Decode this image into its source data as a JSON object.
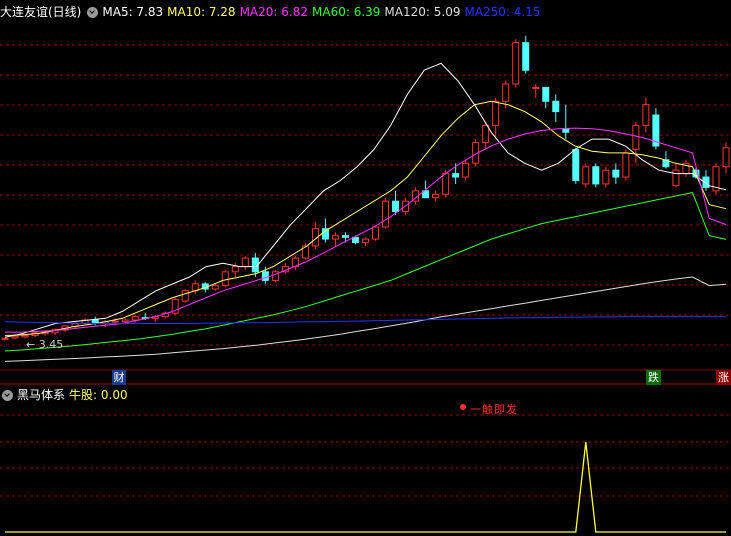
{
  "main_header": {
    "title": "大连友谊(日线)",
    "ma": [
      {
        "label": "MA5: 7.83",
        "color": "#ffffff"
      },
      {
        "label": "MA10: 7.28",
        "color": "#ffff66"
      },
      {
        "label": "MA20: 6.82",
        "color": "#ff33ff"
      },
      {
        "label": "MA60: 6.39",
        "color": "#33ff33"
      },
      {
        "label": "MA120: 5.09",
        "color": "#dddddd"
      },
      {
        "label": "MA250: 4.15",
        "color": "#2233ff"
      }
    ]
  },
  "low_label": "← 3.45",
  "markers": {
    "cai": "财",
    "die": "跌",
    "zhang": "涨"
  },
  "sub_header": {
    "title": "黑马体系",
    "indicator": "牛股: 0.00"
  },
  "signal_text": "一触即发",
  "colors": {
    "up": "#ff3333",
    "down": "#54ffff",
    "bg": "#000000",
    "grid": "#8b0000"
  },
  "chart_data": {
    "type": "candlestick",
    "ohlc": [
      [
        3.5,
        3.55,
        3.45,
        3.52
      ],
      [
        3.53,
        3.6,
        3.5,
        3.58
      ],
      [
        3.56,
        3.62,
        3.52,
        3.6
      ],
      [
        3.6,
        3.7,
        3.55,
        3.68
      ],
      [
        3.65,
        3.72,
        3.6,
        3.7
      ],
      [
        3.68,
        3.8,
        3.62,
        3.78
      ],
      [
        3.76,
        3.9,
        3.7,
        3.88
      ],
      [
        3.86,
        4.0,
        3.8,
        3.95
      ],
      [
        3.95,
        4.1,
        3.9,
        4.05
      ],
      [
        4.05,
        4.15,
        3.9,
        3.95
      ],
      [
        3.95,
        4.05,
        3.85,
        4.0
      ],
      [
        4.0,
        4.1,
        3.9,
        4.02
      ],
      [
        4.0,
        4.1,
        3.92,
        4.05
      ],
      [
        4.05,
        4.2,
        3.98,
        4.15
      ],
      [
        4.12,
        4.25,
        4.05,
        4.1
      ],
      [
        4.1,
        4.2,
        4.0,
        4.15
      ],
      [
        4.15,
        4.3,
        4.1,
        4.25
      ],
      [
        4.25,
        4.7,
        4.2,
        4.65
      ],
      [
        4.6,
        4.95,
        4.55,
        4.9
      ],
      [
        4.9,
        5.2,
        4.8,
        5.1
      ],
      [
        5.1,
        5.15,
        4.85,
        4.95
      ],
      [
        4.95,
        5.1,
        4.9,
        5.05
      ],
      [
        5.05,
        5.5,
        5.0,
        5.45
      ],
      [
        5.45,
        5.7,
        5.3,
        5.6
      ],
      [
        5.6,
        5.9,
        5.5,
        5.85
      ],
      [
        5.85,
        6.0,
        5.3,
        5.45
      ],
      [
        5.45,
        5.6,
        5.1,
        5.2
      ],
      [
        5.2,
        5.5,
        5.15,
        5.45
      ],
      [
        5.45,
        5.7,
        5.4,
        5.6
      ],
      [
        5.6,
        5.9,
        5.5,
        5.85
      ],
      [
        5.85,
        6.3,
        5.8,
        6.2
      ],
      [
        6.2,
        6.9,
        6.1,
        6.7
      ],
      [
        6.7,
        7.0,
        6.3,
        6.4
      ],
      [
        6.4,
        6.6,
        6.2,
        6.5
      ],
      [
        6.5,
        6.6,
        6.3,
        6.45
      ],
      [
        6.45,
        6.5,
        6.25,
        6.3
      ],
      [
        6.3,
        6.45,
        6.2,
        6.4
      ],
      [
        6.4,
        6.8,
        6.35,
        6.75
      ],
      [
        6.75,
        7.6,
        6.7,
        7.5
      ],
      [
        7.5,
        7.8,
        7.1,
        7.2
      ],
      [
        7.2,
        7.6,
        7.1,
        7.5
      ],
      [
        7.5,
        7.9,
        7.4,
        7.8
      ],
      [
        7.8,
        8.1,
        7.7,
        7.6
      ],
      [
        7.6,
        7.8,
        7.5,
        7.7
      ],
      [
        7.7,
        8.4,
        7.6,
        8.3
      ],
      [
        8.3,
        8.6,
        8.0,
        8.2
      ],
      [
        8.2,
        8.7,
        8.1,
        8.6
      ],
      [
        8.6,
        9.3,
        8.5,
        9.2
      ],
      [
        9.2,
        9.8,
        9.0,
        9.7
      ],
      [
        9.7,
        10.5,
        9.3,
        10.4
      ],
      [
        10.4,
        11.0,
        10.2,
        10.9
      ],
      [
        10.9,
        12.2,
        10.8,
        12.1
      ],
      [
        12.1,
        12.3,
        11.2,
        11.3
      ],
      [
        10.8,
        10.9,
        10.5,
        10.8
      ],
      [
        10.8,
        10.8,
        10.2,
        10.4
      ],
      [
        10.4,
        10.6,
        9.8,
        10.1
      ],
      [
        9.6,
        10.3,
        9.3,
        9.5
      ],
      [
        9.0,
        9.05,
        8.0,
        8.1
      ],
      [
        8.0,
        8.6,
        7.9,
        8.5
      ],
      [
        8.5,
        8.6,
        7.9,
        8.0
      ],
      [
        8.0,
        8.5,
        7.9,
        8.4
      ],
      [
        8.4,
        8.6,
        8.0,
        8.2
      ],
      [
        8.2,
        9.0,
        8.1,
        8.9
      ],
      [
        9.0,
        9.8,
        8.6,
        9.7
      ],
      [
        9.7,
        10.5,
        9.5,
        10.3
      ],
      [
        10.0,
        10.2,
        9.0,
        9.1
      ],
      [
        8.7,
        8.95,
        8.45,
        8.5
      ],
      [
        7.95,
        8.6,
        7.9,
        8.4
      ],
      [
        8.3,
        8.7,
        8.2,
        8.6
      ],
      [
        8.4,
        8.45,
        8.15,
        8.2
      ],
      [
        8.2,
        8.4,
        7.8,
        7.9
      ],
      [
        7.8,
        8.6,
        7.7,
        8.5
      ],
      [
        8.5,
        9.2,
        8.3,
        9.05
      ]
    ],
    "ma_series": [
      {
        "name": "MA5",
        "color": "#ffffff",
        "values": [
          3.55,
          3.65,
          3.8,
          3.95,
          4.0,
          4.05,
          4.1,
          4.3,
          4.6,
          4.9,
          5.1,
          5.3,
          5.6,
          5.7,
          5.6,
          5.6,
          6.2,
          6.8,
          7.3,
          7.8,
          8.1,
          8.5,
          9.0,
          9.7,
          10.6,
          11.3,
          11.5,
          11.0,
          10.3,
          9.5,
          8.9,
          8.6,
          8.4,
          8.6,
          9.0,
          9.3,
          9.3,
          9.1,
          8.7,
          8.4,
          8.3,
          8.3,
          7.95,
          7.83
        ]
      },
      {
        "name": "MA10",
        "color": "#ffff66",
        "values": [
          3.6,
          3.62,
          3.66,
          3.75,
          3.85,
          3.92,
          4.0,
          4.1,
          4.3,
          4.5,
          4.7,
          4.85,
          5.0,
          5.2,
          5.3,
          5.4,
          5.6,
          5.9,
          6.2,
          6.6,
          6.9,
          7.2,
          7.5,
          7.8,
          8.2,
          8.8,
          9.4,
          9.9,
          10.3,
          10.4,
          10.3,
          10.1,
          9.8,
          9.4,
          9.1,
          8.95,
          8.9,
          8.9,
          8.85,
          8.75,
          8.6,
          8.5,
          7.4,
          7.28
        ]
      },
      {
        "name": "MA20",
        "color": "#ff33ff",
        "values": [
          3.7,
          3.7,
          3.72,
          3.75,
          3.8,
          3.85,
          3.9,
          3.95,
          4.05,
          4.15,
          4.3,
          4.5,
          4.7,
          4.9,
          5.05,
          5.2,
          5.35,
          5.55,
          5.75,
          6.0,
          6.25,
          6.5,
          6.75,
          7.05,
          7.4,
          7.8,
          8.2,
          8.55,
          8.85,
          9.1,
          9.3,
          9.45,
          9.55,
          9.6,
          9.62,
          9.6,
          9.55,
          9.45,
          9.35,
          9.2,
          9.05,
          8.9,
          7.0,
          6.82
        ]
      },
      {
        "name": "MA60",
        "color": "#33ff33",
        "values": [
          3.15,
          3.18,
          3.22,
          3.26,
          3.3,
          3.35,
          3.4,
          3.45,
          3.5,
          3.57,
          3.64,
          3.72,
          3.8,
          3.9,
          4.0,
          4.1,
          4.2,
          4.32,
          4.45,
          4.6,
          4.75,
          4.9,
          5.05,
          5.2,
          5.4,
          5.6,
          5.8,
          6.0,
          6.2,
          6.4,
          6.55,
          6.7,
          6.85,
          6.95,
          7.05,
          7.15,
          7.25,
          7.35,
          7.45,
          7.55,
          7.65,
          7.75,
          6.5,
          6.39
        ]
      },
      {
        "name": "MA120",
        "color": "#dddddd",
        "values": [
          2.85,
          2.87,
          2.89,
          2.91,
          2.93,
          2.95,
          2.98,
          3.0,
          3.03,
          3.06,
          3.1,
          3.14,
          3.18,
          3.22,
          3.27,
          3.32,
          3.38,
          3.44,
          3.5,
          3.57,
          3.64,
          3.72,
          3.8,
          3.88,
          3.96,
          4.05,
          4.14,
          4.22,
          4.3,
          4.38,
          4.46,
          4.54,
          4.62,
          4.7,
          4.78,
          4.86,
          4.94,
          5.02,
          5.1,
          5.17,
          5.24,
          5.3,
          5.05,
          5.09
        ]
      },
      {
        "name": "MA250",
        "color": "#2233ff",
        "values": [
          4.0,
          3.99,
          3.98,
          3.97,
          3.96,
          3.95,
          3.95,
          3.95,
          3.95,
          3.95,
          3.95,
          3.95,
          3.96,
          3.96,
          3.97,
          3.97,
          3.98,
          3.99,
          4.0,
          4.0,
          4.01,
          4.02,
          4.03,
          4.04,
          4.05,
          4.06,
          4.07,
          4.08,
          4.09,
          4.1,
          4.11,
          4.12,
          4.12,
          4.13,
          4.13,
          4.14,
          4.14,
          4.15,
          4.15,
          4.15,
          4.15,
          4.15,
          4.15,
          4.15
        ]
      }
    ],
    "sub_indicator": {
      "name": "牛股",
      "values": [
        0,
        0,
        0,
        0,
        0,
        0,
        0,
        0,
        0,
        0,
        0,
        0,
        0,
        0,
        0,
        0,
        0,
        0,
        0,
        0,
        0,
        0,
        0,
        0,
        0,
        0,
        0,
        0,
        0,
        0,
        0,
        0,
        0,
        0,
        0,
        0,
        0,
        0,
        0,
        0,
        0,
        0,
        0,
        0,
        0,
        0,
        0,
        0,
        0,
        0,
        0,
        0,
        0,
        0,
        0,
        0,
        0,
        0,
        0,
        0,
        0,
        0,
        0,
        0,
        0,
        0,
        0,
        0,
        0,
        0,
        0,
        0,
        0
      ],
      "peak_index": null,
      "peak_value": 1
    }
  }
}
